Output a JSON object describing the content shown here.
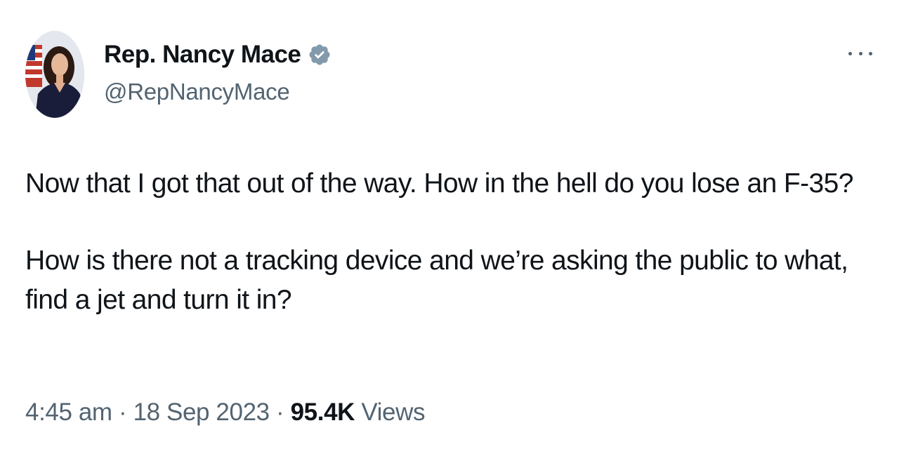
{
  "author": {
    "display_name": "Rep. Nancy Mace",
    "handle": "@RepNancyMace",
    "verified_icon": "verified-badge-icon"
  },
  "tweet": {
    "paragraphs": [
      "Now that I got that out of the way. How in the hell do you lose an F-35?",
      "How is there not a tracking device and we’re asking the public to what, find a jet and turn it in?"
    ]
  },
  "meta": {
    "time": "4:45 am",
    "separator": " · ",
    "date": "18 Sep 2023",
    "views_count": "95.4K",
    "views_label": " Views"
  },
  "icons": {
    "more": "more-options-icon"
  },
  "colors": {
    "text_primary": "#0f1419",
    "text_secondary": "#536471",
    "verified_gray": "#829aab"
  }
}
